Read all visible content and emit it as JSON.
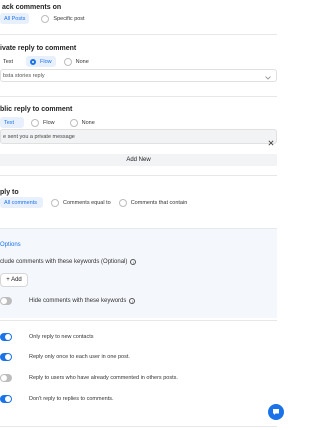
{
  "track_comments": {
    "title": "ack comments on",
    "options": [
      "All Posts",
      "Specific post"
    ],
    "selected": 0
  },
  "private_reply": {
    "title": "ivate reply to comment",
    "options": [
      "Text",
      "Flow",
      "None"
    ],
    "selected": 1,
    "flow_select_value": "bsta stories reply",
    "chevron": "chevron-down-icon"
  },
  "public_reply": {
    "title": "blic reply to comment",
    "options": [
      "Text",
      "Flow",
      "None"
    ],
    "selected": 0,
    "input_value": "e sent you a private message",
    "clear_icon": "close-icon",
    "add_new_label": "Add New"
  },
  "reply_to": {
    "title": "ply to",
    "options": [
      "All comments",
      "Comments equal to",
      "Comments that contain"
    ],
    "selected": 0
  },
  "options_section": {
    "title": "Options",
    "include_label": "clude comments with these keywords (Optional)",
    "add_label": "+ Add",
    "hide_label": "Hide comments with these keywords",
    "info_icon": "info-icon"
  },
  "toggles": [
    {
      "label": "Only reply to new contacts",
      "on": true
    },
    {
      "label": "Reply only once to each user in one post.",
      "on": true
    },
    {
      "label": "Reply to users who have already commented in others posts.",
      "on": false
    },
    {
      "label": "Don't reply to replies to comments.",
      "on": true
    }
  ],
  "hide_toggle": {
    "on": false
  },
  "colors": {
    "accent": "#1a73e8",
    "toggle_off": "#bdbdbd",
    "pill_bg": "#e8f0fe"
  },
  "fab_icon": "chat-bubble-icon"
}
